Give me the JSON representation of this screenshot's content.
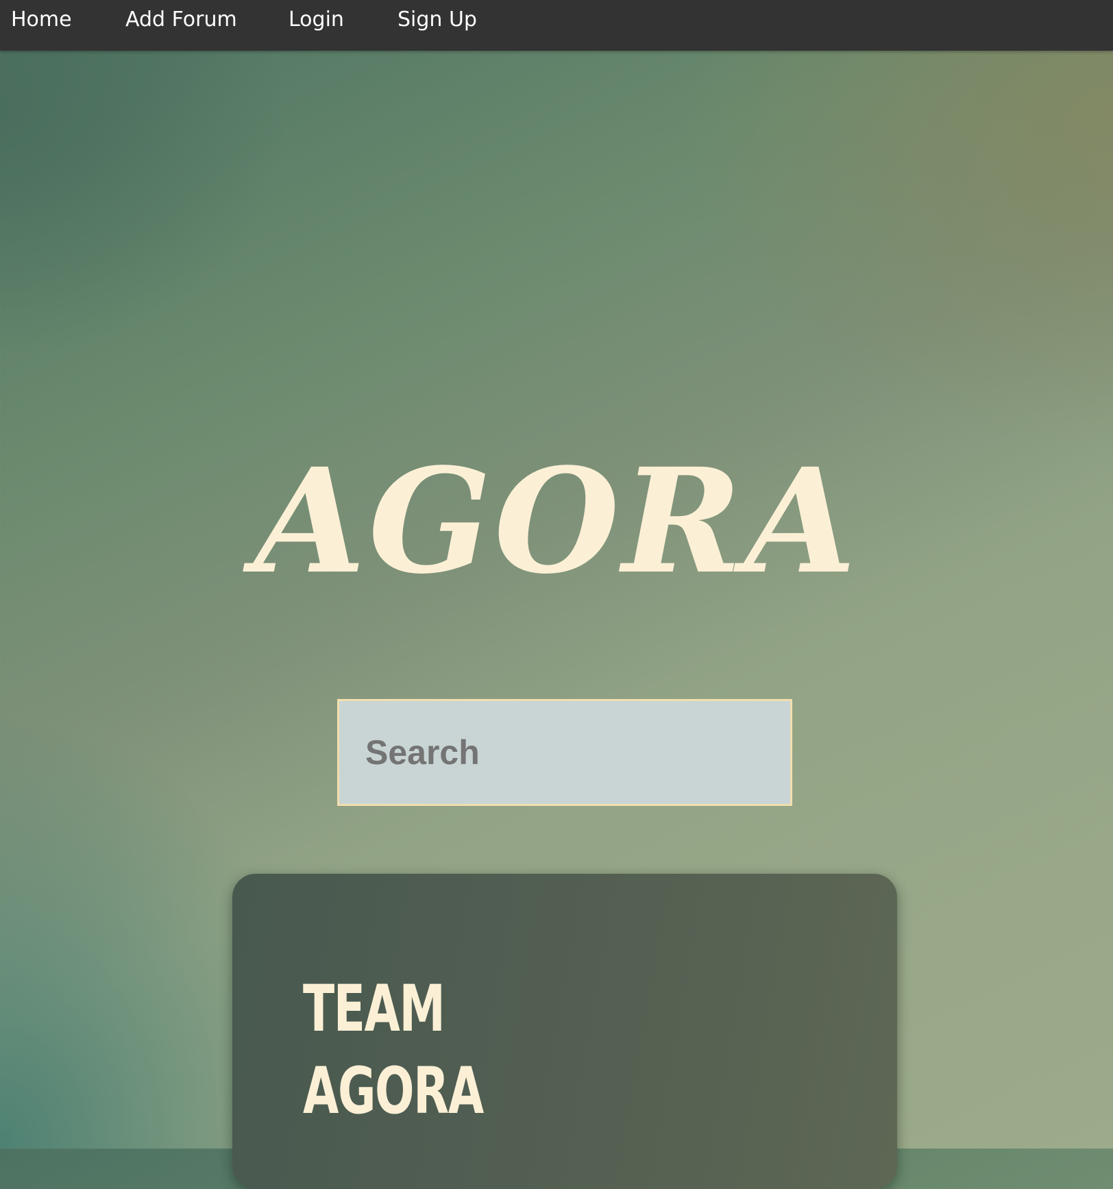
{
  "nav": {
    "items": [
      {
        "label": "Home"
      },
      {
        "label": "Add Forum"
      },
      {
        "label": "Login"
      },
      {
        "label": "Sign Up"
      }
    ]
  },
  "hero": {
    "brand": "AGORA"
  },
  "search": {
    "placeholder": "Search",
    "value": ""
  },
  "card": {
    "title_line1": "TEAM",
    "title_line2": "AGORA"
  },
  "colors": {
    "navbar_bg": "#333333",
    "brand_text": "#fbf0d6",
    "search_bg": "#c9d4d4",
    "search_border": "#f2dfae",
    "card_bg": "#525e52"
  }
}
